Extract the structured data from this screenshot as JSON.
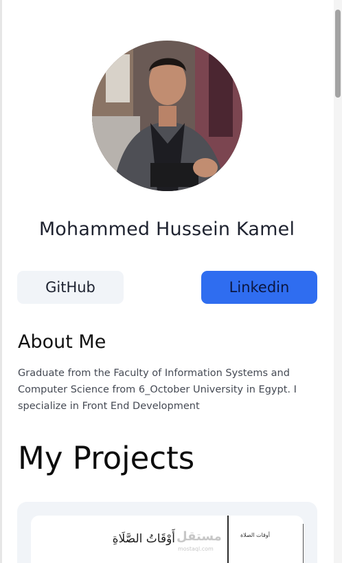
{
  "profile": {
    "name": "Mohammed Hussein Kamel",
    "photo_alt": "profile photo"
  },
  "links": {
    "github_label": "GitHub",
    "linkedin_label": "Linkedin"
  },
  "about": {
    "title": "About Me",
    "text": "Graduate from the Faculty of Information Systems and Computer Science from 6_October University in Egypt. I specialize in Front End Development"
  },
  "projects": {
    "title": "My Projects",
    "items": [
      {
        "preview_title": "أَوْقَاتُ الصَّلَاةِ",
        "preview_side_title": "أوقات الصلاة",
        "watermark": "مستقل",
        "watermark_sub": "mostaql.com"
      }
    ]
  },
  "colors": {
    "linkedin_button": "#2f6df0",
    "github_button": "#f1f4f8",
    "card_background": "#f1f4f8"
  }
}
